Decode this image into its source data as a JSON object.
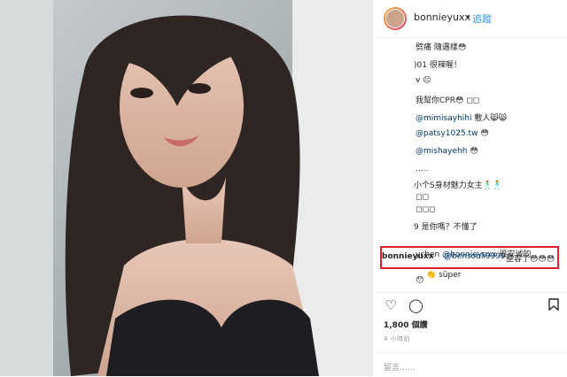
{
  "post": {
    "username": "bonnieyuxx",
    "separator": "•",
    "follow_label": "追蹤"
  },
  "comments": [
    {
      "text": "劈痛 隨遇樣😳"
    },
    {
      "text": ")01 很辣喔！"
    },
    {
      "text": "v ☹"
    },
    {
      "text": "我幫你CPR😳 ◻◻"
    },
    {
      "mention": "@mimisayhihi",
      "text": "敷人😸😸"
    },
    {
      "mention": "@patsy1025.tw",
      "text": "😳"
    },
    {
      "mention": "@mishayehh",
      "text": "😳"
    },
    {
      "text": "....."
    },
    {
      "text": "小个S身材魅力女主🕺🕺"
    },
    {
      "text": "◻◻"
    },
    {
      "text": "◻◻◻"
    },
    {
      "text": "9 是你嗎？不懂了"
    }
  ],
  "highlighted_reply": {
    "username": "bonnieyuxx",
    "mention": "@bensonli9999",
    "text": "整容了😳😳😳"
  },
  "after_comments": [
    {
      "text": "😯"
    },
    {
      "text": "ychen",
      "mention": "@bonnieyuxx",
      "tail": "很安诚的"
    },
    {
      "text": "süper",
      "prefix": "👏"
    }
  ],
  "actions": {
    "like_icon": "heart-icon",
    "comment_icon": "comment-icon",
    "save_icon": "bookmark-icon"
  },
  "likes_text": "1,800 個讚",
  "time_text": "4 小時前",
  "add_comment_placeholder": "留言……"
}
